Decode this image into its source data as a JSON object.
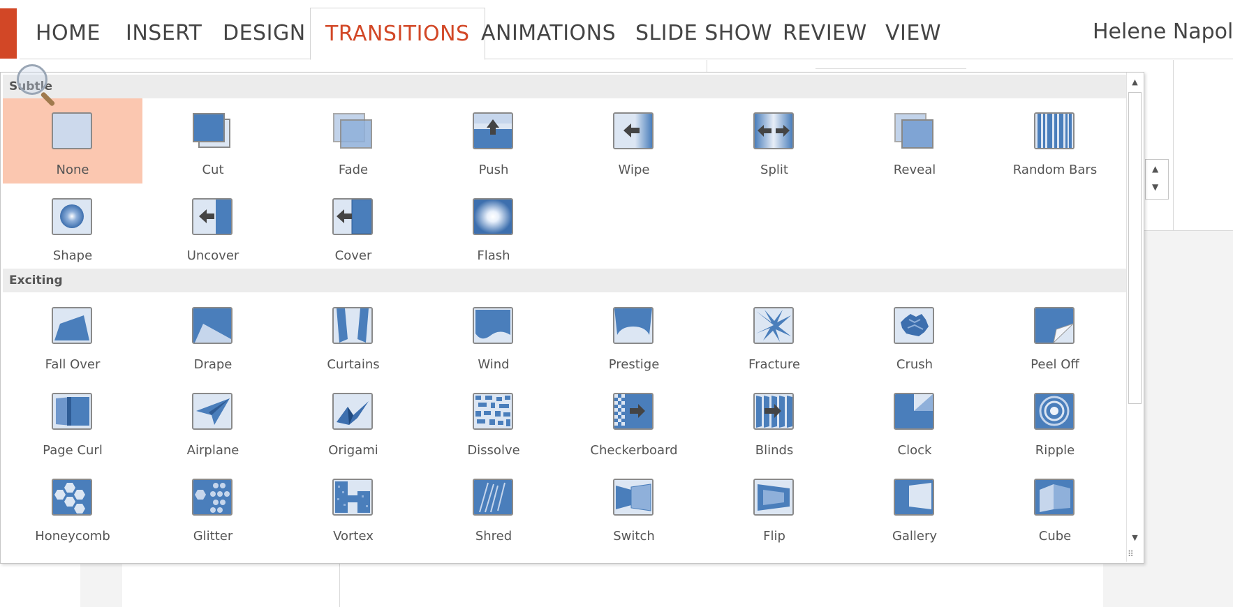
{
  "ribbon": {
    "tabs": [
      {
        "label": "HOME"
      },
      {
        "label": "INSERT"
      },
      {
        "label": "DESIGN"
      },
      {
        "label": "TRANSITIONS"
      },
      {
        "label": "ANIMATIONS"
      },
      {
        "label": "SLIDE SHOW"
      },
      {
        "label": "REVIEW"
      },
      {
        "label": "VIEW"
      }
    ],
    "active_tab": "TRANSITIONS",
    "user_name": "Helene Napolita"
  },
  "colors": {
    "accent": "#d24726",
    "selected_bg": "#fbc7b0",
    "icon_blue": "#4a7ebb"
  },
  "gallery": {
    "sections": [
      {
        "title": "Subtle",
        "items": [
          {
            "label": "None",
            "icon": "none-icon",
            "selected": true
          },
          {
            "label": "Cut",
            "icon": "cut-icon"
          },
          {
            "label": "Fade",
            "icon": "fade-icon"
          },
          {
            "label": "Push",
            "icon": "push-icon"
          },
          {
            "label": "Wipe",
            "icon": "wipe-icon"
          },
          {
            "label": "Split",
            "icon": "split-icon"
          },
          {
            "label": "Reveal",
            "icon": "reveal-icon"
          },
          {
            "label": "Random Bars",
            "icon": "random-bars-icon"
          },
          {
            "label": "Shape",
            "icon": "shape-icon"
          },
          {
            "label": "Uncover",
            "icon": "uncover-icon"
          },
          {
            "label": "Cover",
            "icon": "cover-icon"
          },
          {
            "label": "Flash",
            "icon": "flash-icon"
          }
        ]
      },
      {
        "title": "Exciting",
        "items": [
          {
            "label": "Fall Over",
            "icon": "fall-over-icon"
          },
          {
            "label": "Drape",
            "icon": "drape-icon"
          },
          {
            "label": "Curtains",
            "icon": "curtains-icon"
          },
          {
            "label": "Wind",
            "icon": "wind-icon"
          },
          {
            "label": "Prestige",
            "icon": "prestige-icon"
          },
          {
            "label": "Fracture",
            "icon": "fracture-icon"
          },
          {
            "label": "Crush",
            "icon": "crush-icon"
          },
          {
            "label": "Peel Off",
            "icon": "peel-off-icon"
          },
          {
            "label": "Page Curl",
            "icon": "page-curl-icon"
          },
          {
            "label": "Airplane",
            "icon": "airplane-icon"
          },
          {
            "label": "Origami",
            "icon": "origami-icon"
          },
          {
            "label": "Dissolve",
            "icon": "dissolve-icon"
          },
          {
            "label": "Checkerboard",
            "icon": "checkerboard-icon"
          },
          {
            "label": "Blinds",
            "icon": "blinds-icon"
          },
          {
            "label": "Clock",
            "icon": "clock-icon"
          },
          {
            "label": "Ripple",
            "icon": "ripple-icon"
          },
          {
            "label": "Honeycomb",
            "icon": "honeycomb-icon"
          },
          {
            "label": "Glitter",
            "icon": "glitter-icon"
          },
          {
            "label": "Vortex",
            "icon": "vortex-icon"
          },
          {
            "label": "Shred",
            "icon": "shred-icon"
          },
          {
            "label": "Switch",
            "icon": "switch-icon"
          },
          {
            "label": "Flip",
            "icon": "flip-icon"
          },
          {
            "label": "Gallery",
            "icon": "gallery-icon"
          },
          {
            "label": "Cube",
            "icon": "cube-icon"
          }
        ]
      }
    ]
  }
}
